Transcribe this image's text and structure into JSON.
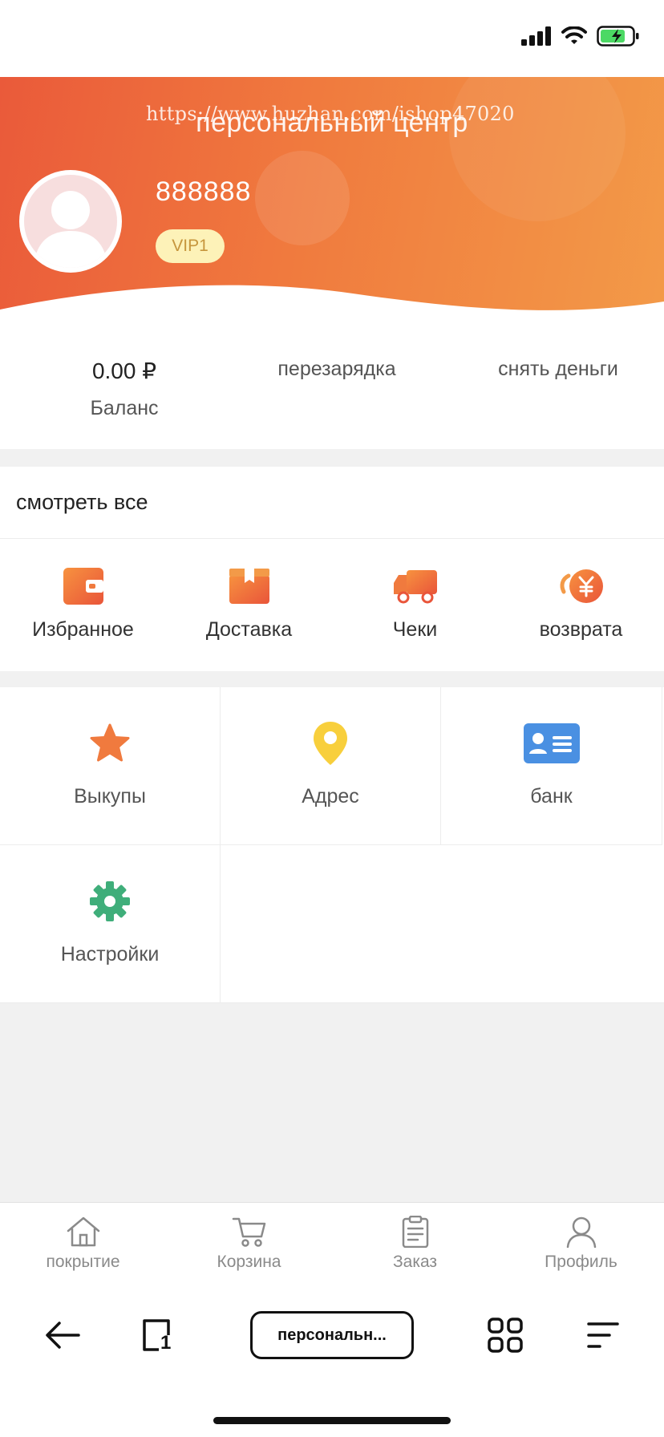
{
  "header": {
    "title": "персональный центр",
    "watermark": "https://www.huzhan.com/ishop47020",
    "username": "888888",
    "vip": "VIP1",
    "colors": {
      "start": "#ea5a3a",
      "end": "#f39a48"
    }
  },
  "balance": {
    "value": "0.00 ₽",
    "label": "Баланс",
    "recharge": "перезарядка",
    "withdraw": "снять деньги"
  },
  "orders": {
    "see_all": "смотреть все",
    "items": [
      {
        "label": "Избранное",
        "icon": "wallet-icon"
      },
      {
        "label": "Доставка",
        "icon": "box-icon"
      },
      {
        "label": "Чеки",
        "icon": "truck-icon"
      },
      {
        "label": "возврата",
        "icon": "yuan-coin-icon"
      }
    ]
  },
  "menu": {
    "items": [
      {
        "label": "Выкупы",
        "icon": "star-icon",
        "color": "#f07a3e"
      },
      {
        "label": "Адрес",
        "icon": "location-pin-icon",
        "color": "#f8cf3c"
      },
      {
        "label": "банк",
        "icon": "id-card-icon",
        "color": "#4a90e2"
      },
      {
        "label": "Настройки",
        "icon": "gear-icon",
        "color": "#3fae7a"
      }
    ]
  },
  "tabbar": {
    "items": [
      {
        "label": "покрытие",
        "icon": "home-icon"
      },
      {
        "label": "Корзина",
        "icon": "cart-icon"
      },
      {
        "label": "Заказ",
        "icon": "clipboard-icon"
      },
      {
        "label": "Профиль",
        "icon": "user-icon"
      }
    ]
  },
  "browser": {
    "url_label": "персональн...",
    "tab_count": "1"
  }
}
